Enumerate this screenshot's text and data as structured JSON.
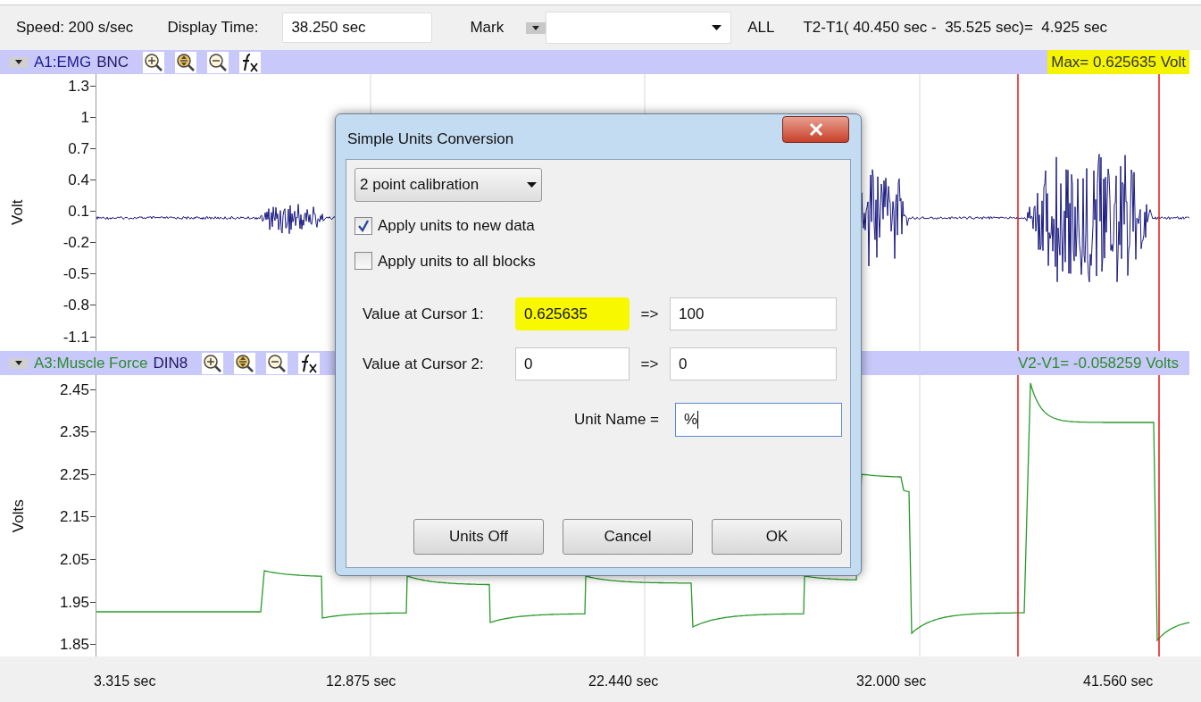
{
  "toolbar": {
    "speed": "Speed: 200 s/sec",
    "display_time_label": "Display Time:",
    "display_time": "38.250 sec",
    "mark_label": "Mark",
    "all": "ALL",
    "interval": "T2-T1( 40.450 sec -  35.525 sec)=  4.925 sec"
  },
  "channels": [
    {
      "name": "A1:EMG",
      "color": "#1c1c8e",
      "source": "BNC",
      "readout": "Max= 0.625635 Volt",
      "readout_highlighted": true,
      "y_label": "Volt",
      "y_ticks": [
        "1.3",
        "1",
        "0.7",
        "0.4",
        "0.1",
        "-0.2",
        "-0.5",
        "-0.8",
        "-1.1"
      ],
      "kind": "emg"
    },
    {
      "name": "A3:Muscle Force",
      "color": "#2e8b2e",
      "source": "DIN8",
      "readout": "V2-V1= -0.058259 Volts",
      "readout_highlighted": false,
      "y_label": "Volts",
      "y_ticks": [
        "2.45",
        "2.35",
        "2.25",
        "2.15",
        "2.05",
        "1.95",
        "1.85"
      ],
      "kind": "force"
    }
  ],
  "time_axis": [
    "3.315 sec",
    "12.875 sec",
    "22.440 sec",
    "32.000 sec",
    "41.560 sec"
  ],
  "dialog": {
    "title": "Simple Units Conversion",
    "mode": "2 point calibration",
    "options": [
      {
        "label": "Apply units to new data",
        "checked": true
      },
      {
        "label": "Apply units to all blocks",
        "checked": false
      }
    ],
    "cursors": [
      {
        "label": "Value at Cursor 1:",
        "value": "0.625635",
        "highlighted": true,
        "arrow": "=>",
        "result": "100"
      },
      {
        "label": "Value at Cursor 2:",
        "value": "0",
        "highlighted": false,
        "arrow": "=>",
        "result": "0"
      }
    ],
    "unit_name_label": "Unit Name =",
    "unit_name": "%",
    "buttons": [
      "Units Off",
      "Cancel",
      "OK"
    ]
  }
}
